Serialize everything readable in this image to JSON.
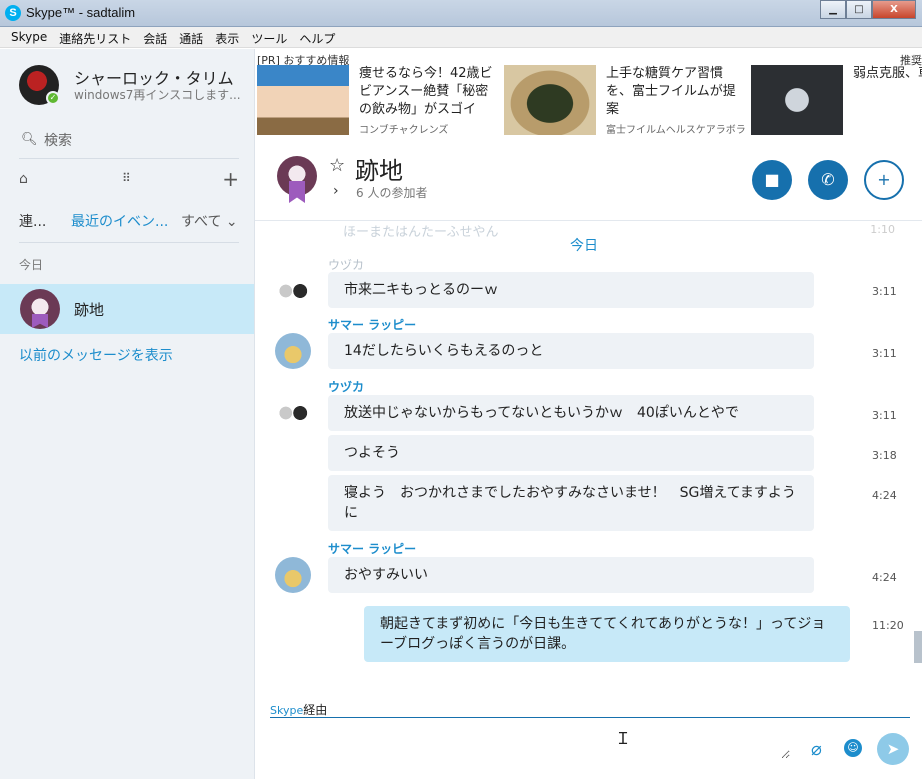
{
  "window": {
    "title": "Skype™ - sadtalim",
    "app_icon": "S",
    "minimize": "▁",
    "maximize": "□",
    "close": "X"
  },
  "menu": [
    "Skype",
    "連絡先リスト",
    "会話",
    "通話",
    "表示",
    "ツール",
    "ヘルプ"
  ],
  "profile": {
    "name": "シャーロック・タリム",
    "mood": "windows7再インスコします..."
  },
  "search": {
    "placeholder": "検索"
  },
  "tabs": {
    "contacts": "連...",
    "recent": "最近のイベン...",
    "all": "すべて"
  },
  "sidebar": {
    "section_today": "今日",
    "show_older": "以前のメッセージを表示"
  },
  "conversation_item": {
    "name": "跡地"
  },
  "ads": {
    "label": "[PR] おすすめ情報",
    "label_right": "推奨",
    "items": [
      {
        "text": "痩せるなら今！42歳ビビアンスー絶賛「秘密の飲み物」がスゴイ",
        "source": "コンブチャクレンズ"
      },
      {
        "text": "上手な糖質ケア習慣を、富士フイルムが提案",
        "source": "富士フイルムヘルスケアラボラ"
      },
      {
        "text": "弱点克服、車するクモ型ロ"
      }
    ]
  },
  "chat": {
    "title": "跡地",
    "participants": "6 人の参加者",
    "ghost_text": "ほーまたはんたーふせやん",
    "ghost_time": "1:10",
    "ghost_sender": "ウヅカ",
    "day_separator": "今日",
    "messages": [
      {
        "text": "市来二キもっとるのーｗ",
        "time": "3:11"
      },
      {
        "sender": "サマー ラッピー",
        "text": "14だしたらいくらもえるのっと",
        "time": "3:11"
      },
      {
        "sender": "ウヅカ",
        "text": "放送中じゃないからもってないともいうかｗ　40ぽいんとやで",
        "time": "3:11"
      },
      {
        "text": "つよそう",
        "time": "3:18"
      },
      {
        "text": "寝よう　おつかれさまでしたおやすみなさいませ！　SG増えてますように",
        "time": "4:24"
      },
      {
        "sender": "サマー ラッピー",
        "text": "おやすみいい",
        "time": "4:24"
      },
      {
        "text": "朝起きてまず初めに「今日も生きててくれてありがとうな！」ってジョーブログっぽく言うのが日課。",
        "time": "11:20"
      }
    ]
  },
  "compose": {
    "via_prefix": "Skype",
    "via_suffix": "経由"
  }
}
